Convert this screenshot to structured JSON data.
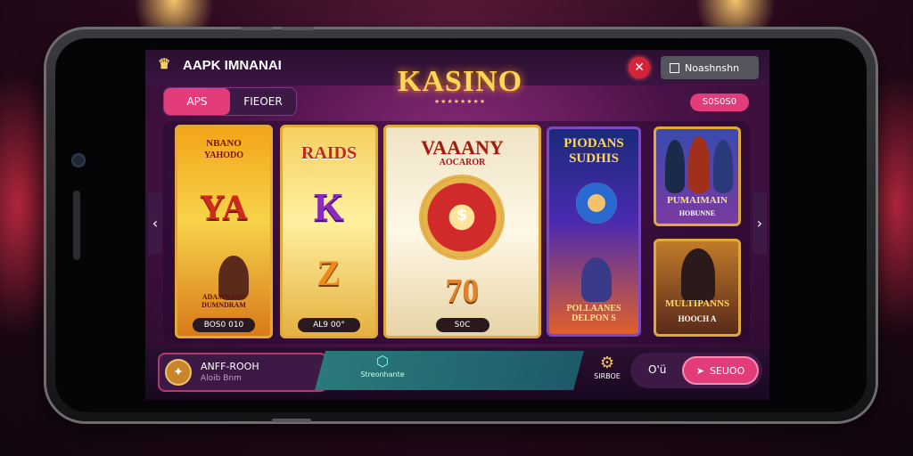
{
  "app": {
    "brand_name": "AAPK IMNANAI",
    "logo_text": "KASINO",
    "logo_sub": "★★★★★★★★"
  },
  "topbar": {
    "close_icon": "close-icon",
    "account_label": "Noashnshn"
  },
  "tabs": [
    {
      "label": "APS",
      "active": true
    },
    {
      "label": "FIEOER",
      "active": false
    }
  ],
  "badge": {
    "label": "S0S0S0"
  },
  "cards": [
    {
      "title": "NBANO",
      "subtitle": "YAHODO",
      "big": "YA",
      "caption": "ADAMNANO\nDUMNDRAM",
      "pill": "BOS0 010"
    },
    {
      "title": "RAIDS",
      "big": "K",
      "big2": "Z",
      "pill": "AL9 00°"
    },
    {
      "title": "VAAANY",
      "subtitle": "AOCAROR",
      "big": "70",
      "pill": "S0C"
    },
    {
      "title": "PIODANS SUDHIS",
      "caption": "POLLAANES DELPON S",
      "pill": ""
    },
    {
      "title": "PUMAIMAIN",
      "subtitle": "HOBUNNE"
    },
    {
      "title": "MULTIPANNS",
      "subtitle": "HOOCH A"
    }
  ],
  "bottom": {
    "user_name": "ANFF-ROOH",
    "user_sub": "Aloib Bnm",
    "mid_label": "Streonhante",
    "gear_label": "SIRBOE",
    "action_icons": "O'ü",
    "play_label": "SEUOO"
  }
}
